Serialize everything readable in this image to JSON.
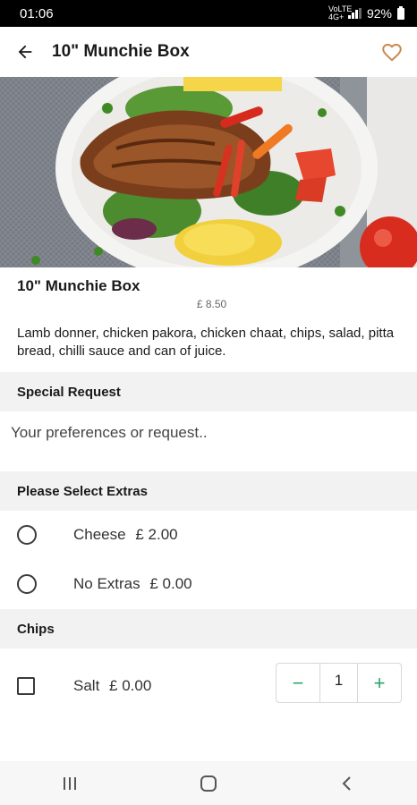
{
  "status_bar": {
    "time": "01:06",
    "network": "VoLTE 4G+",
    "battery": "92%"
  },
  "app_bar": {
    "title": "10\" Munchie Box",
    "back_icon": "arrow-left-icon",
    "favorite_icon": "heart-outline-icon"
  },
  "product": {
    "name": "10\" Munchie Box",
    "price": "£ 8.50",
    "description": "Lamb donner, chicken pakora, chicken chaat, chips, salad, pitta bread, chilli sauce and can of juice."
  },
  "special_request": {
    "heading": "Special Request",
    "placeholder": "Your preferences or request..",
    "value": ""
  },
  "extras": {
    "heading": "Please Select Extras",
    "options": [
      {
        "label": "Cheese",
        "price": "£ 2.00",
        "selected": false
      },
      {
        "label": "No Extras",
        "price": "£ 0.00",
        "selected": false
      }
    ]
  },
  "chips": {
    "heading": "Chips",
    "options": [
      {
        "label": "Salt",
        "price": "£ 0.00",
        "checked": false,
        "quantity": "1"
      }
    ],
    "decrement_label": "−",
    "increment_label": "+"
  },
  "colors": {
    "accent_green": "#2ba36a",
    "heart": "#c9874a",
    "section_bg": "#f2f2f2"
  }
}
